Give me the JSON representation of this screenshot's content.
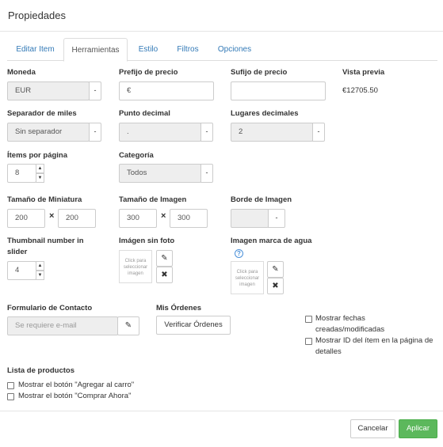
{
  "dialog": {
    "title": "Propiedades"
  },
  "tabs": [
    {
      "label": "Editar Item"
    },
    {
      "label": "Herramientas"
    },
    {
      "label": "Estilo"
    },
    {
      "label": "Filtros"
    },
    {
      "label": "Opciones"
    }
  ],
  "moneda": {
    "label": "Moneda",
    "value": "EUR"
  },
  "prefijo": {
    "label": "Prefijo de precio",
    "value": "€"
  },
  "sufijo": {
    "label": "Sufijo de precio",
    "value": ""
  },
  "vista_previa": {
    "label": "Vista previa",
    "value": "€12705.50"
  },
  "separador": {
    "label": "Separador de miles",
    "value": "Sin separador"
  },
  "punto_decimal": {
    "label": "Punto decimal",
    "value": "."
  },
  "lugares_decimales": {
    "label": "Lugares decimales",
    "value": "2"
  },
  "items_pagina": {
    "label": "Ítems por página",
    "value": "8"
  },
  "categoria": {
    "label": "Categoría",
    "value": "Todos"
  },
  "miniatura": {
    "label": "Tamaño de Miniatura",
    "width": "200",
    "height": "200"
  },
  "imagen": {
    "label": "Tamaño de Imagen",
    "width": "300",
    "height": "300"
  },
  "borde": {
    "label": "Borde de Imagen"
  },
  "thumb_slider": {
    "label_line1": "Thumbnail number in",
    "label_line2": "slider",
    "value": "4"
  },
  "imagen_sin_foto": {
    "label": "Imágen sin foto",
    "placeholder": "Click para seleccionar imagen"
  },
  "marca_agua": {
    "label": "Imagen marca de agua",
    "help": "?",
    "placeholder": "Click para seleccionar imagen"
  },
  "times_glyph": "×",
  "formulario": {
    "label": "Formulario de Contacto",
    "placeholder": "Se requiere e-mail"
  },
  "ordenes": {
    "label": "Mis Órdenes",
    "button": "Verificar Órdenes"
  },
  "checks_right": [
    {
      "line1": "Mostrar fechas",
      "line2": "creadas/modificadas"
    },
    {
      "line1": "Mostrar ID del ítem en la página de",
      "line2": "detalles"
    }
  ],
  "lista": {
    "label": "Lista de productos",
    "items": [
      {
        "label": "Mostrar el botón \"Agregar al carro\""
      },
      {
        "label": "Mostrar el botón \"Comprar Ahora\""
      }
    ]
  },
  "footer": {
    "cancel": "Cancelar",
    "apply": "Aplicar"
  },
  "colors": {
    "primary": "#5cb85c",
    "link": "#337ab7"
  }
}
